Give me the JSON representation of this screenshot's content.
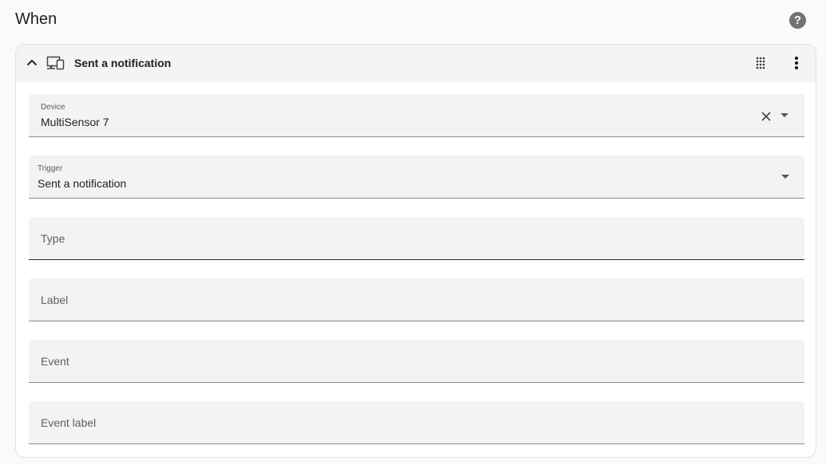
{
  "section": {
    "title": "When",
    "help_icon": "help-circle-icon"
  },
  "trigger_card": {
    "title": "Sent a notification",
    "icons": {
      "expand": "chevron-up-icon",
      "device": "devices-icon",
      "drag": "drag-handle-icon",
      "menu": "dots-vertical-icon"
    },
    "fields": {
      "device": {
        "label": "Device",
        "value": "MultiSensor 7"
      },
      "trigger": {
        "label": "Trigger",
        "value": "Sent a notification"
      },
      "type": {
        "placeholder": "Type"
      },
      "label": {
        "placeholder": "Label"
      },
      "event": {
        "placeholder": "Event"
      },
      "event_label": {
        "placeholder": "Event label"
      }
    }
  },
  "colors": {
    "page_background": "#fafafa",
    "card_header_background": "#f4f4f4",
    "field_background": "#f3f3f3",
    "icon_grey": "#727272"
  }
}
